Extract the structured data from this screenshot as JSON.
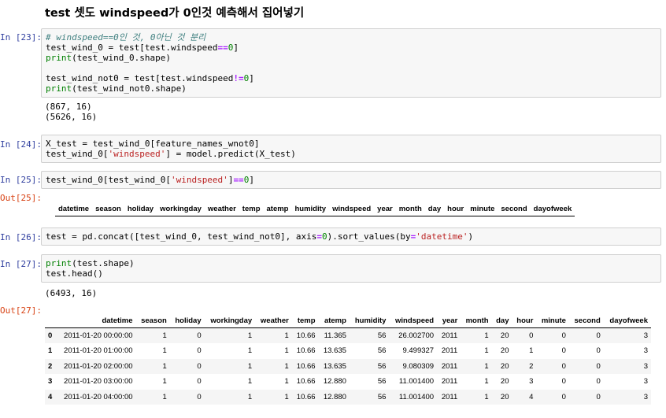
{
  "heading": "test 셋도 windspeed가 0인것 예측해서 집어넣기",
  "cells": [
    {
      "prompt": "In [23]:",
      "lines": [
        [
          [
            "cm",
            "# windspeed==0인 것, 0아닌 것 분리"
          ]
        ],
        [
          [
            "",
            "test_wind_0 = test[test.windspeed"
          ],
          [
            "op",
            "=="
          ],
          [
            "nm",
            "0"
          ],
          [
            "",
            "]"
          ]
        ],
        [
          [
            "kw",
            "print"
          ],
          [
            "",
            "(test_wind_0.shape)"
          ]
        ],
        [
          [
            "",
            ""
          ]
        ],
        [
          [
            "",
            "test_wind_not0 = test[test.windspeed"
          ],
          [
            "op",
            "!="
          ],
          [
            "nm",
            "0"
          ],
          [
            "",
            "]"
          ]
        ],
        [
          [
            "kw",
            "print"
          ],
          [
            "",
            "(test_wind_not0.shape)"
          ]
        ]
      ],
      "output": "(867, 16)\n(5626, 16)"
    },
    {
      "prompt": "In [24]:",
      "lines": [
        [
          [
            "",
            "X_test = test_wind_0[feature_names_wnot0]"
          ]
        ],
        [
          [
            "",
            "test_wind_0["
          ],
          [
            "st",
            "'windspeed'"
          ],
          [
            "",
            "] = model.predict(X_test)"
          ]
        ]
      ]
    },
    {
      "prompt": "In [25]:",
      "lines": [
        [
          [
            "",
            "test_wind_0[test_wind_0["
          ],
          [
            "st",
            "'windspeed'"
          ],
          [
            "",
            "]"
          ],
          [
            "op",
            "=="
          ],
          [
            "nm",
            "0"
          ],
          [
            "",
            "]"
          ]
        ]
      ],
      "out_prompt": "Out[25]:"
    },
    {
      "prompt": "In [26]:",
      "lines": [
        [
          [
            "",
            "test = pd.concat([test_wind_0, test_wind_not0], axis"
          ],
          [
            "op",
            "="
          ],
          [
            "nm",
            "0"
          ],
          [
            "",
            ").sort_values(by"
          ],
          [
            "op",
            "="
          ],
          [
            "st",
            "'datetime'"
          ],
          [
            "",
            ")"
          ]
        ]
      ]
    },
    {
      "prompt": "In [27]:",
      "lines": [
        [
          [
            "kw",
            "print"
          ],
          [
            "",
            "(test.shape)"
          ]
        ],
        [
          [
            "",
            "test.head()"
          ]
        ]
      ],
      "output": "(6493, 16)",
      "out_prompt": "Out[27]:"
    }
  ],
  "columns": [
    "datetime",
    "season",
    "holiday",
    "workingday",
    "weather",
    "temp",
    "atemp",
    "humidity",
    "windspeed",
    "year",
    "month",
    "day",
    "hour",
    "minute",
    "second",
    "dayofweek"
  ],
  "rows": [
    [
      "0",
      "2011-01-20 00:00:00",
      "1",
      "0",
      "1",
      "1",
      "10.66",
      "11.365",
      "56",
      "26.002700",
      "2011",
      "1",
      "20",
      "0",
      "0",
      "0",
      "3"
    ],
    [
      "1",
      "2011-01-20 01:00:00",
      "1",
      "0",
      "1",
      "1",
      "10.66",
      "13.635",
      "56",
      "9.499327",
      "2011",
      "1",
      "20",
      "1",
      "0",
      "0",
      "3"
    ],
    [
      "2",
      "2011-01-20 02:00:00",
      "1",
      "0",
      "1",
      "1",
      "10.66",
      "13.635",
      "56",
      "9.080309",
      "2011",
      "1",
      "20",
      "2",
      "0",
      "0",
      "3"
    ],
    [
      "3",
      "2011-01-20 03:00:00",
      "1",
      "0",
      "1",
      "1",
      "10.66",
      "12.880",
      "56",
      "11.001400",
      "2011",
      "1",
      "20",
      "3",
      "0",
      "0",
      "3"
    ],
    [
      "4",
      "2011-01-20 04:00:00",
      "1",
      "0",
      "1",
      "1",
      "10.66",
      "12.880",
      "56",
      "11.001400",
      "2011",
      "1",
      "20",
      "4",
      "0",
      "0",
      "3"
    ]
  ]
}
